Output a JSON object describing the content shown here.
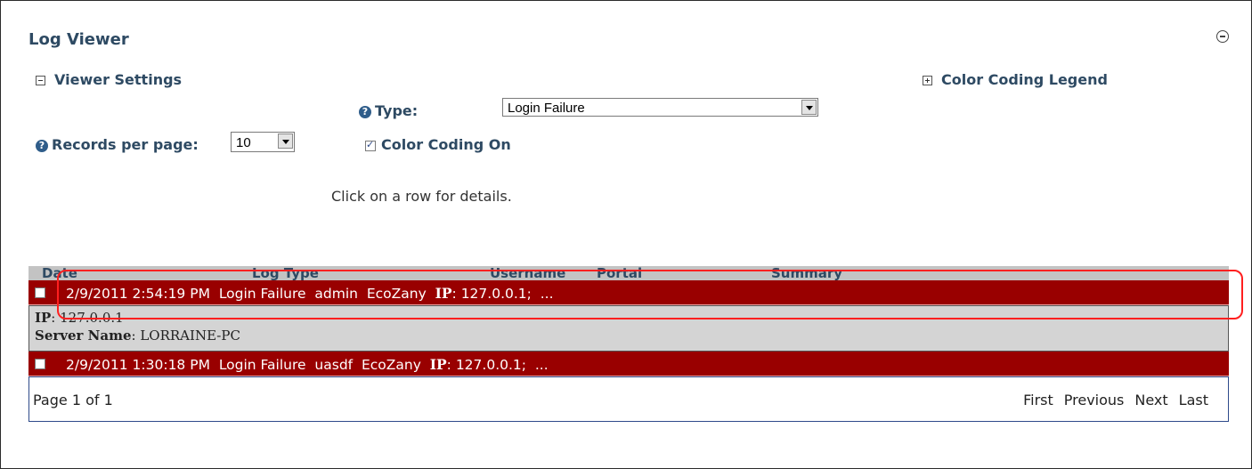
{
  "title": "Log Viewer",
  "viewer_settings": "Viewer Settings",
  "color_legend": "Color Coding Legend",
  "type_label": "Type:",
  "type_value": "Login Failure",
  "rpp_label": "Records per page:",
  "rpp_value": "10",
  "color_coding": "Color Coding On",
  "hint": "Click on a row for details.",
  "headers": [
    "Date",
    "Log Type",
    "Username",
    "Portal",
    "Summary"
  ],
  "rows": [
    {
      "date": "2/9/2011 2:54:19 PM",
      "log_type": "Login Failure",
      "username": "admin",
      "portal": "EcoZany",
      "summary_key": "IP",
      "summary_val": ": 127.0.0.1;  ..."
    },
    {
      "date": "2/9/2011 1:30:18 PM",
      "log_type": "Login Failure",
      "username": "uasdf",
      "portal": "EcoZany",
      "summary_key": "IP",
      "summary_val": ": 127.0.0.1;  ..."
    }
  ],
  "detail": {
    "ip_label": "IP",
    "ip_value": ": 127.0.0.1",
    "server_label": "Server Name",
    "server_value": ": LORRAINE-PC"
  },
  "pager": {
    "text": "Page 1 of 1",
    "first": "First",
    "previous": "Previous",
    "next": "Next",
    "last": "Last"
  },
  "colors": {
    "row": "#990000",
    "header": "#2e4a63",
    "highlight": "#ff1f1f"
  }
}
